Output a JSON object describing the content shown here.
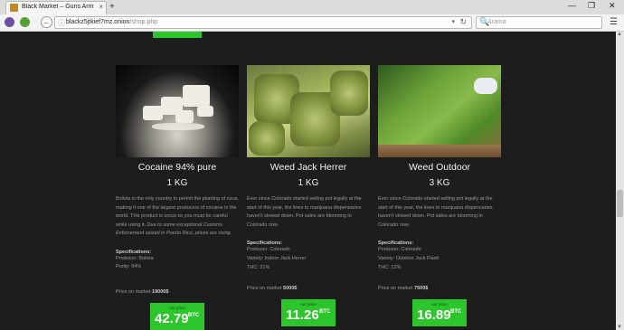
{
  "browser": {
    "tab_title": "Black Market – Guns Arms ...",
    "tab_close": "×",
    "new_tab": "+",
    "win_min": "—",
    "win_max": "❐",
    "win_close": "✕",
    "url_host": "blackz5jtkief7mz.onion",
    "url_path": "/shop.php",
    "search_placeholder": "Arama",
    "back_glyph": "←",
    "info_glyph": "ⓘ",
    "reload_glyph": "↻",
    "drop_glyph": "▾",
    "menu_glyph": "☰",
    "search_glyph": "🔍"
  },
  "products": [
    {
      "name": "Cocaine 94% pure",
      "qty": "1 KG",
      "desc_plain": "Bolivia is the only country to permit the planting of coca, making it one of the largest producers of cocaine in the world. This product is uncut so you must be careful while using it.",
      "desc_italic": "Due to some exceptional Customs Enforcement seized in Puerto Rico, prices are rising.",
      "spec_heading": "Specifications:",
      "spec_1": "Producer: Bolivia",
      "spec_2": "Purity: 94%",
      "spec_3": "",
      "market_label": "Price on market",
      "market_value": "19000$",
      "price_label": "our price",
      "price_value": "42.79",
      "price_currency": "BTC"
    },
    {
      "name": "Weed Jack Herrer",
      "qty": "1 KG",
      "desc_plain": "Ever since Colorado started selling pot legally at the start of this year, the lines to marijuana dispensaries haven't slowed down. Pot sales are blooming in Colorado now.",
      "desc_italic": "",
      "spec_heading": "Specifications:",
      "spec_1": "Producer: Colorado",
      "spec_2": "Variety: Indoor Jack Herrer",
      "spec_3": "THC: 21%",
      "market_label": "Price on market",
      "market_value": "5000$",
      "price_label": "our price",
      "price_value": "11.26",
      "price_currency": "BTC"
    },
    {
      "name": "Weed Outdoor",
      "qty": "3 KG",
      "desc_plain": "Ever since Colorado started selling pot legally at the start of this year, the lines to marijuana dispensaries haven't slowed down. Pot sales are blooming in Colorado now.",
      "desc_italic": "",
      "spec_heading": "Specifications:",
      "spec_1": "Producer: Colorado",
      "spec_2": "Variety: Outdoor Jack Flash",
      "spec_3": "THC: 12%",
      "market_label": "Price on market",
      "market_value": "7500$",
      "price_label": "our price",
      "price_value": "16.89",
      "price_currency": "BTC"
    }
  ],
  "colors": {
    "accent_green": "#2cc52c",
    "page_bg": "#1d1d1d"
  }
}
